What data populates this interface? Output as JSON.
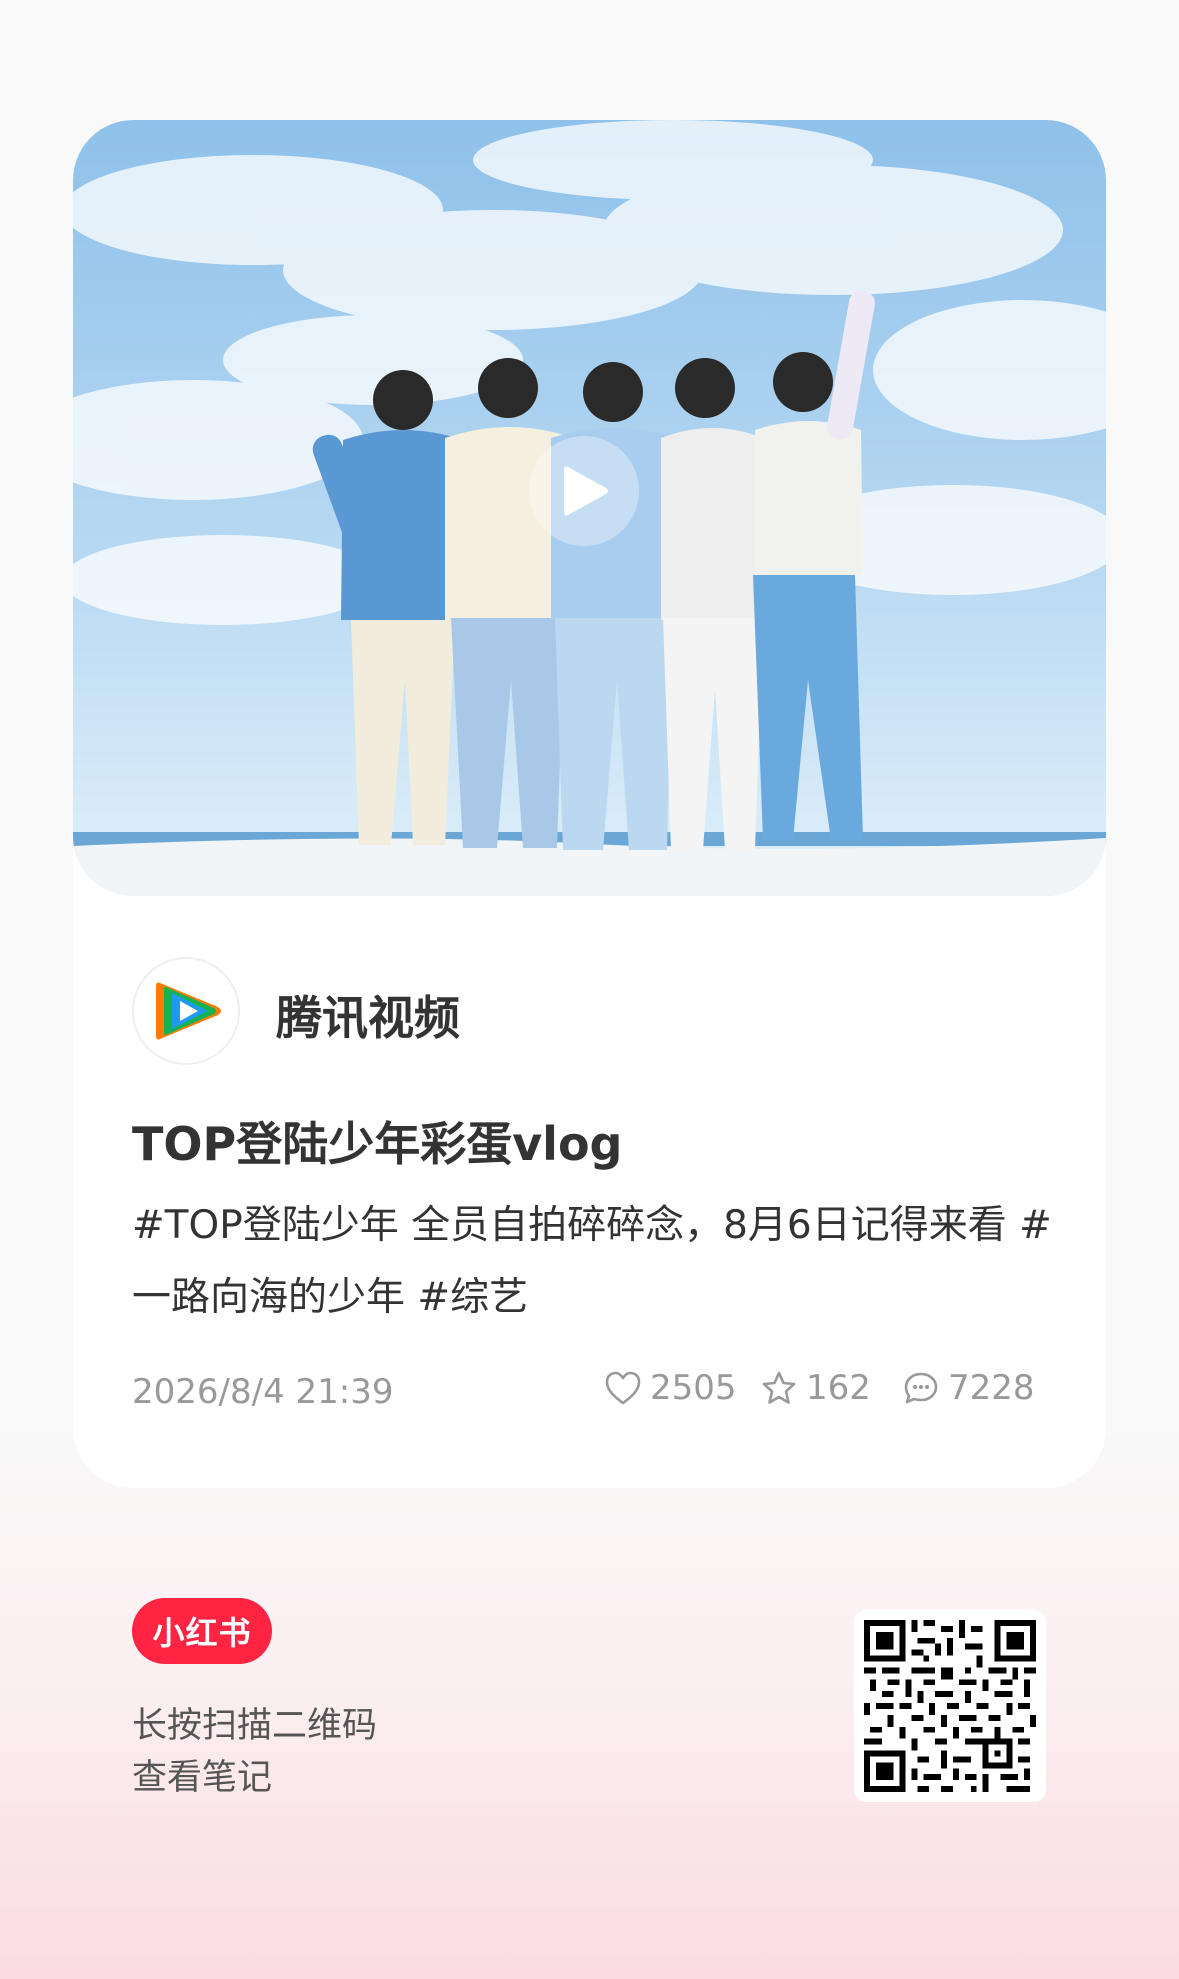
{
  "post": {
    "author": "腾讯视频",
    "title": "TOP登陆少年彩蛋vlog",
    "description": "#TOP登陆少年  全员自拍碎碎念，8月6日记得来看 #一路向海的少年  #综艺",
    "time": "2026/8/4 21:39",
    "likes": "2505",
    "collects": "162",
    "comments": "7228"
  },
  "share": {
    "brand": "小红书",
    "hint_line1": "长按扫描二维码",
    "hint_line2": "查看笔记"
  },
  "icons": {
    "play": "play-icon",
    "like": "heart-icon",
    "collect": "star-icon",
    "comment": "comment-bubble-icon",
    "avatar": "tencent-video-logo"
  },
  "colors": {
    "brand": "#ff2442",
    "meta": "#999999",
    "text": "#333333"
  }
}
